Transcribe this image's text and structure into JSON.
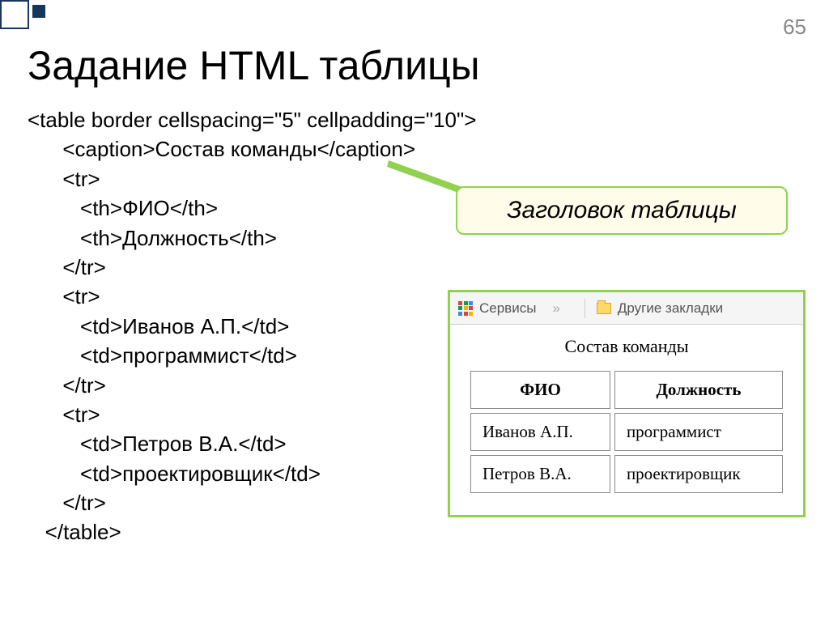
{
  "page_number": "65",
  "title": "Задание HTML таблицы",
  "code": {
    "l1": "<table border cellspacing=\"5\" cellpadding=\"10\">",
    "l2": "      <caption>Состав команды</caption>",
    "l3": "      <tr>",
    "l4": "         <th>ФИО</th>",
    "l5": "         <th>Должность</th>",
    "l6": "      </tr>",
    "l7": "      <tr>",
    "l8": "         <td>Иванов А.П.</td>",
    "l9": "         <td>программист</td>",
    "l10": "      </tr>",
    "l11": "      <tr>",
    "l12": "         <td>Петров В.А.</td>",
    "l13": "         <td>проектировщик</td>",
    "l14": "      </tr>",
    "l15": "   </table>"
  },
  "callout": "Заголовок таблицы",
  "browser": {
    "services": "Сервисы",
    "more": "»",
    "bookmarks": "Другие закладки"
  },
  "demo": {
    "caption": "Состав команды",
    "headers": {
      "col1": "ФИО",
      "col2": "Должность"
    },
    "rows": {
      "r1c1": "Иванов А.П.",
      "r1c2": "программист",
      "r2c1": "Петров В.А.",
      "r2c2": "проектировщик"
    }
  }
}
